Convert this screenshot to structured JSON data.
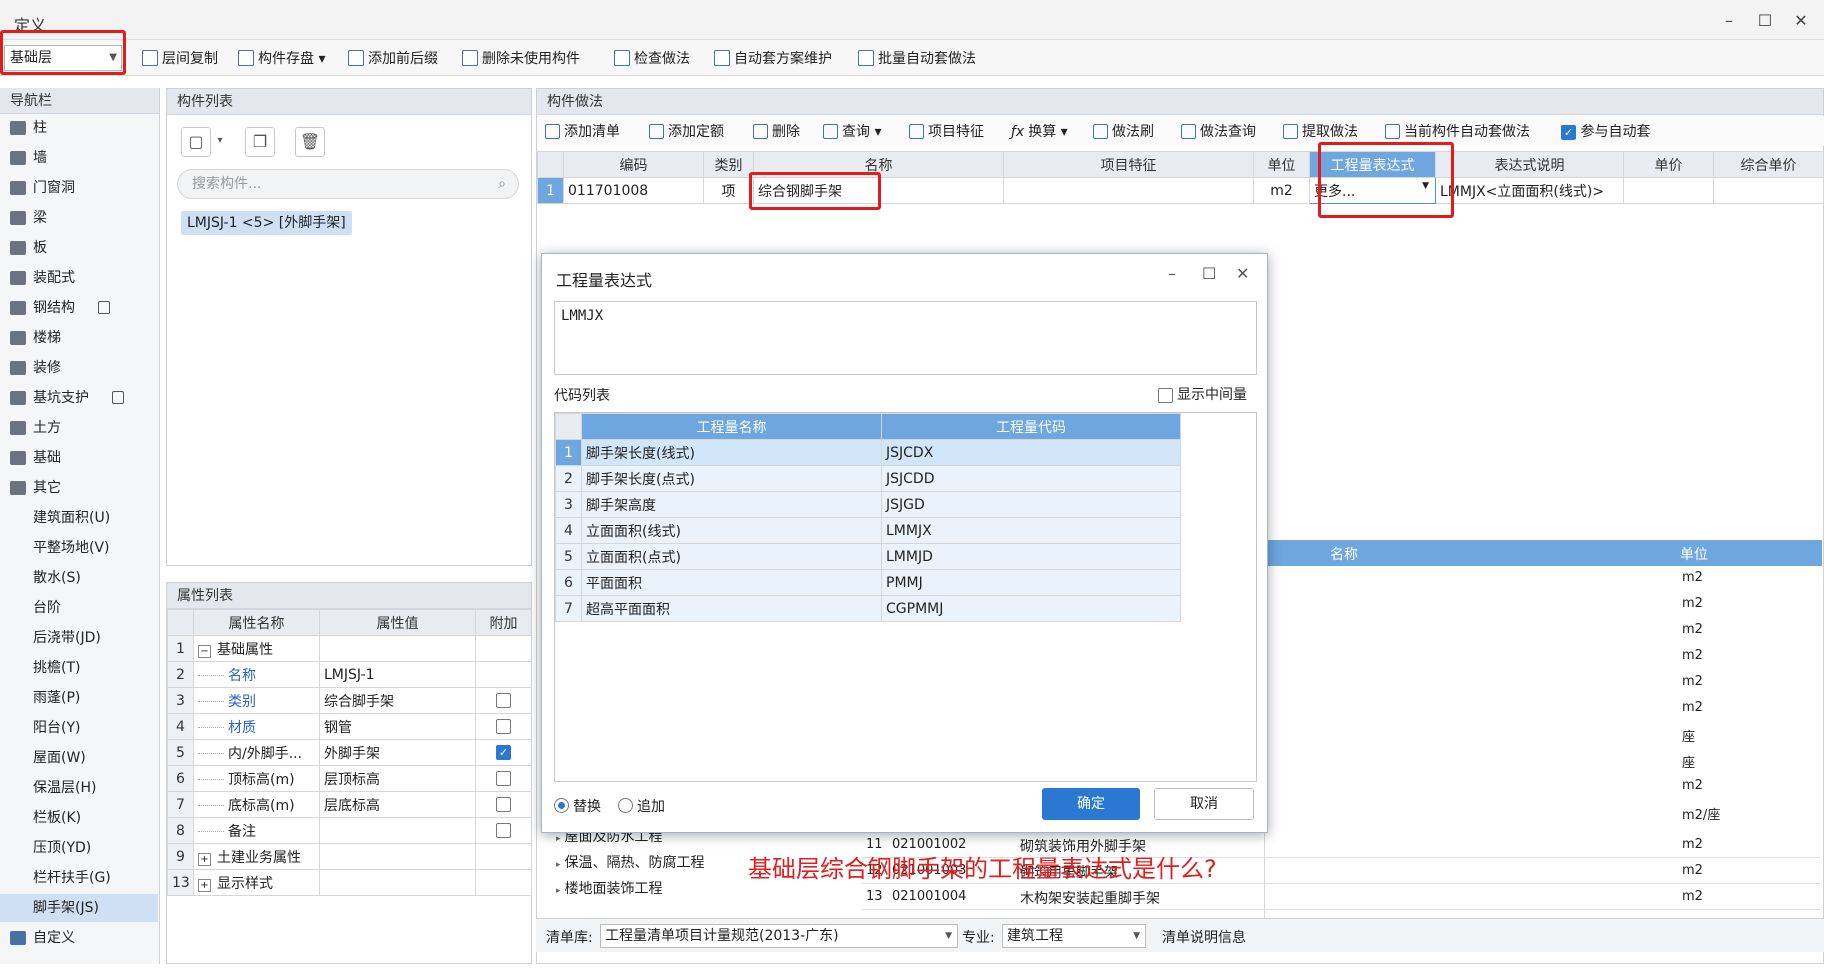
{
  "window": {
    "title": "定义",
    "minimize": "–",
    "maximize": "☐",
    "close": "✕"
  },
  "toolbar": {
    "layer": "基础层",
    "items": [
      "层间复制",
      "构件存盘",
      "添加前后缀",
      "删除未使用构件",
      "检查做法",
      "自动套方案维护",
      "批量自动套做法"
    ]
  },
  "nav": {
    "title": "导航栏",
    "items": [
      "柱",
      "墙",
      "门窗洞",
      "梁",
      "板",
      "装配式",
      "钢结构",
      "楼梯",
      "装修",
      "基坑支护",
      "土方",
      "基础",
      "其它"
    ],
    "sub_items": [
      "建筑面积(U)",
      "平整场地(V)",
      "散水(S)",
      "台阶",
      "后浇带(JD)",
      "挑檐(T)",
      "雨蓬(P)",
      "阳台(Y)",
      "屋面(W)",
      "保温层(H)",
      "栏板(K)",
      "压顶(YD)",
      "栏杆扶手(G)",
      "脚手架(JS)"
    ],
    "custom": "自定义"
  },
  "component_list": {
    "title": "构件列表",
    "search_placeholder": "搜索构件...",
    "item": "LMJSJ-1 <5> [外脚手架]"
  },
  "properties": {
    "title": "属性列表",
    "headers": [
      "属性名称",
      "属性值",
      "附加"
    ],
    "rows": [
      {
        "n": "1",
        "name": "基础属性",
        "value": "",
        "expander": "−"
      },
      {
        "n": "2",
        "name": "名称",
        "value": "LMJSJ-1"
      },
      {
        "n": "3",
        "name": "类别",
        "value": "综合脚手架"
      },
      {
        "n": "4",
        "name": "材质",
        "value": "钢管"
      },
      {
        "n": "5",
        "name": "内/外脚手...",
        "value": "外脚手架"
      },
      {
        "n": "6",
        "name": "顶标高(m)",
        "value": "层顶标高"
      },
      {
        "n": "7",
        "name": "底标高(m)",
        "value": "层底标高"
      },
      {
        "n": "8",
        "name": "备注",
        "value": ""
      },
      {
        "n": "9",
        "name": "土建业务属性",
        "value": "",
        "expander": "+"
      },
      {
        "n": "13",
        "name": "显示样式",
        "value": "",
        "expander": "+"
      }
    ]
  },
  "method": {
    "title": "构件做法",
    "toolbar": [
      "添加清单",
      "添加定额",
      "删除",
      "查询",
      "项目特征",
      "换算",
      "做法刷",
      "做法查询",
      "提取做法",
      "当前构件自动套做法",
      "参与自动套"
    ],
    "headers": [
      "编码",
      "类别",
      "名称",
      "项目特征",
      "单位",
      "工程量表达式",
      "表达式说明",
      "单价",
      "综合单价"
    ],
    "row": {
      "n": "1",
      "code": "011701008",
      "type": "项",
      "name": "综合钢脚手架",
      "feature": "",
      "unit": "m2",
      "expr": "更多...",
      "desc": "LMMJX<立面面积(线式)>"
    }
  },
  "lower": {
    "headers": [
      "名称",
      "单位"
    ],
    "units": [
      "m2",
      "m2",
      "m2",
      "m2",
      "m2",
      "m2",
      "座",
      "座",
      "m2",
      "m2/座"
    ],
    "rows": [
      {
        "n": "11",
        "code": "021001002",
        "name": "砌筑装饰用外脚手架",
        "unit": "m2"
      },
      {
        "n": "12",
        "code": "021001003",
        "name": "砌筑用里脚手架",
        "unit": "m2"
      },
      {
        "n": "13",
        "code": "021001004",
        "name": "木构架安装起重脚手架",
        "unit": "m2"
      }
    ],
    "tree": [
      "屋面及防水工程",
      "保温、隔热、防腐工程",
      "楼地面装饰工程"
    ]
  },
  "bottom": {
    "lib_label": "清单库:",
    "lib_value": "工程量清单项目计量规范(2013-广东)",
    "major_label": "专业:",
    "major_value": "建筑工程",
    "info": "清单说明信息"
  },
  "dialog": {
    "title": "工程量表达式",
    "expression": "LMMJX",
    "code_list_label": "代码列表",
    "show_mid": "显示中间量",
    "headers": [
      "工程量名称",
      "工程量代码"
    ],
    "rows": [
      {
        "n": "1",
        "name": "脚手架长度(线式)",
        "code": "JSJCDX"
      },
      {
        "n": "2",
        "name": "脚手架长度(点式)",
        "code": "JSJCDD"
      },
      {
        "n": "3",
        "name": "脚手架高度",
        "code": "JSJGD"
      },
      {
        "n": "4",
        "name": "立面面积(线式)",
        "code": "LMMJX"
      },
      {
        "n": "5",
        "name": "立面面积(点式)",
        "code": "LMMJD"
      },
      {
        "n": "6",
        "name": "平面面积",
        "code": "PMMJ"
      },
      {
        "n": "7",
        "name": "超高平面面积",
        "code": "CGPMMJ"
      }
    ],
    "question": "基础层综合钢脚手架的工程量表达式是什么?",
    "replace": "替换",
    "append": "追加",
    "ok": "确定",
    "cancel": "取消"
  }
}
